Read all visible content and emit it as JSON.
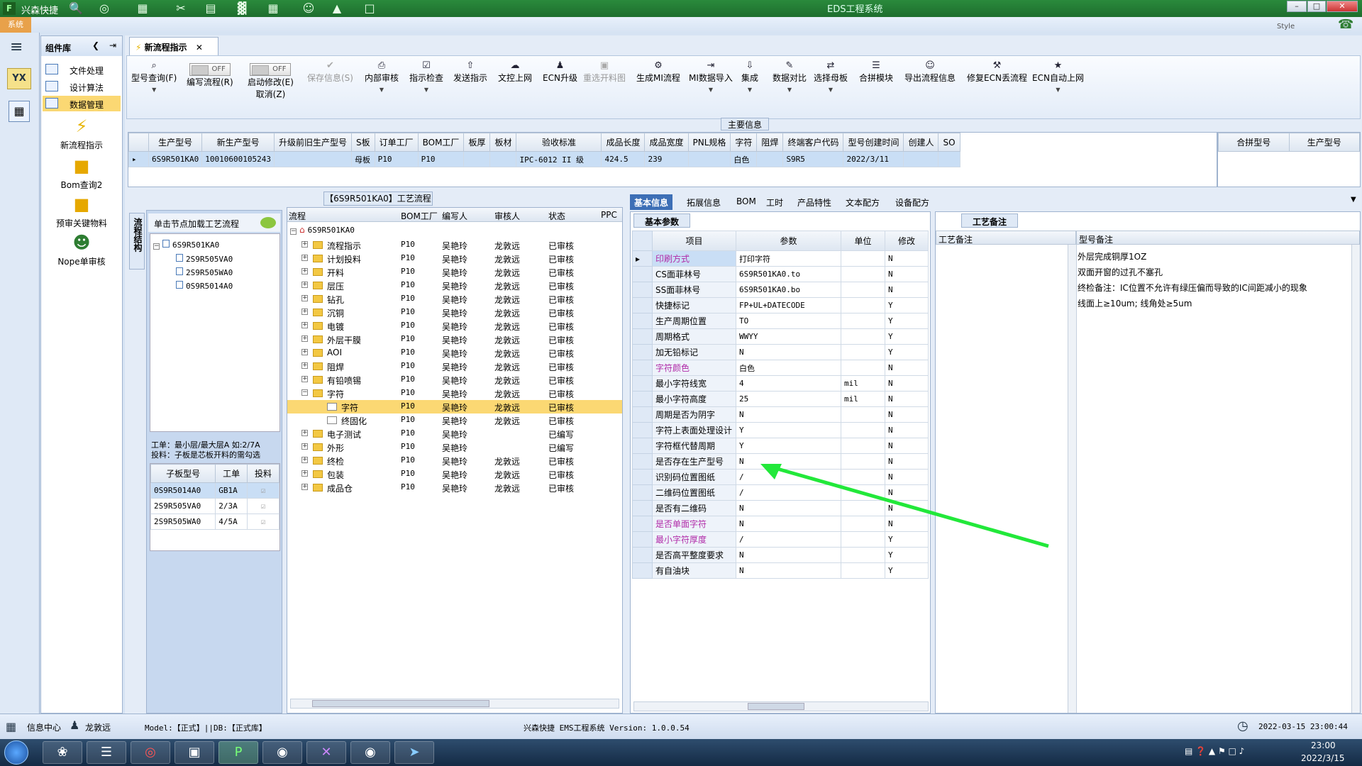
{
  "window": {
    "app_name": "兴森快捷",
    "title": "EDS工程系统",
    "style_label": "Style"
  },
  "sysbar": {
    "tab": "系统"
  },
  "component_panel": {
    "title": "组件库",
    "nav": [
      "文件处理",
      "设计算法",
      "数据管理"
    ],
    "big_buttons": [
      "新流程指示",
      "Bom查询2",
      "预审关键物料",
      "Nope单审核"
    ]
  },
  "doc_tab": {
    "label": "新流程指示"
  },
  "ribbon": {
    "query": "型号查询(F)",
    "write_flow": "编写流程(R)",
    "start_modify": "启动修改(E)",
    "cancel": "取消(Z)",
    "toggle_off": "OFF",
    "save_info": "保存信息(S)",
    "internal_review": "内部审核",
    "check": "指示检查",
    "send": "发送指示",
    "upload": "文控上网",
    "ecn_upgrade": "ECN升级",
    "reselect_image": "重选开料图",
    "gen_mi": "生成MI流程",
    "mi_import": "MI数据导入",
    "integrate": "集成",
    "compare": "数据对比",
    "select_master": "选择母板",
    "merge_module": "合拼模块",
    "export_info": "导出流程信息",
    "fix_ecn": "修复ECN丢流程",
    "ecn_auto": "ECN自动上网"
  },
  "main_info": {
    "label": "主要信息",
    "headers": [
      "生产型号",
      "新生产型号",
      "升级前旧生产型号",
      "S板",
      "订单工厂",
      "BOM工厂",
      "板厚",
      "板材",
      "验收标准",
      "成品长度",
      "成品宽度",
      "PNL规格",
      "字符",
      "阻焊",
      "终端客户代码",
      "型号创建时间",
      "创建人",
      "SO"
    ],
    "row": [
      "6S9R501KA0",
      "10010600105243",
      "",
      "母板",
      "P10",
      "P10",
      "",
      "",
      "IPC-6012 II 级",
      "424.5",
      "239",
      "",
      "白色",
      "",
      "S9R5",
      "2022/3/11",
      "",
      ""
    ],
    "right_headers": [
      "合拼型号",
      "生产型号"
    ]
  },
  "process": {
    "label": "【6S9R501KA0】工艺流程",
    "side_tab": "流程结构",
    "load_hint": "单击节点加载工艺流程",
    "tree_root": "6S9R501KA0",
    "tree_children": [
      "2S9R505VA0",
      "2S9R505WA0",
      "0S9R5014A0"
    ],
    "note_line1": "工单：最小层/最大层A 如:2/7A",
    "note_line2": "投料：子板是芯板开料的需勾选",
    "sub_headers": [
      "子板型号",
      "工单",
      "投料"
    ],
    "sub_rows": [
      [
        "0S9R5014A0",
        "GB1A"
      ],
      [
        "2S9R505VA0",
        "2/3A"
      ],
      [
        "2S9R505WA0",
        "4/5A"
      ]
    ],
    "flow_headers": [
      "流程",
      "BOM工厂",
      "编写人",
      "审核人",
      "状态",
      "PPC"
    ],
    "flow_root": "6S9R501KA0",
    "flow_rows": [
      [
        "流程指示",
        "P10",
        "吴艳玲",
        "龙敦远",
        "已审核"
      ],
      [
        "计划投料",
        "P10",
        "吴艳玲",
        "龙敦远",
        "已审核"
      ],
      [
        "开料",
        "P10",
        "吴艳玲",
        "龙敦远",
        "已审核"
      ],
      [
        "层压",
        "P10",
        "吴艳玲",
        "龙敦远",
        "已审核"
      ],
      [
        "钻孔",
        "P10",
        "吴艳玲",
        "龙敦远",
        "已审核"
      ],
      [
        "沉铜",
        "P10",
        "吴艳玲",
        "龙敦远",
        "已审核"
      ],
      [
        "电镀",
        "P10",
        "吴艳玲",
        "龙敦远",
        "已审核"
      ],
      [
        "外层干膜",
        "P10",
        "吴艳玲",
        "龙敦远",
        "已审核"
      ],
      [
        "AOI",
        "P10",
        "吴艳玲",
        "龙敦远",
        "已审核"
      ],
      [
        "阻焊",
        "P10",
        "吴艳玲",
        "龙敦远",
        "已审核"
      ],
      [
        "有铅喷锡",
        "P10",
        "吴艳玲",
        "龙敦远",
        "已审核"
      ],
      [
        "字符",
        "P10",
        "吴艳玲",
        "龙敦远",
        "已审核"
      ],
      [
        "字符",
        "P10",
        "吴艳玲",
        "龙敦远",
        "已审核"
      ],
      [
        "终固化",
        "P10",
        "吴艳玲",
        "龙敦远",
        "已审核"
      ],
      [
        "电子测试",
        "P10",
        "吴艳玲",
        "",
        "已编写"
      ],
      [
        "外形",
        "P10",
        "吴艳玲",
        "",
        "已编写"
      ],
      [
        "终检",
        "P10",
        "吴艳玲",
        "龙敦远",
        "已审核"
      ],
      [
        "包装",
        "P10",
        "吴艳玲",
        "龙敦远",
        "已审核"
      ],
      [
        "成品仓",
        "P10",
        "吴艳玲",
        "龙敦远",
        "已审核"
      ]
    ]
  },
  "info_tabs": [
    "基本信息",
    "拓展信息",
    "BOM",
    "工时",
    "产品特性",
    "文本配方",
    "设备配方"
  ],
  "params": {
    "label": "基本参数",
    "headers": [
      "项目",
      "参数",
      "单位",
      "修改"
    ],
    "rows": [
      [
        "印刷方式",
        "打印字符",
        "",
        "N"
      ],
      [
        "CS面菲林号",
        "6S9R501KA0.to",
        "",
        "N"
      ],
      [
        "SS面菲林号",
        "6S9R501KA0.bo",
        "",
        "N"
      ],
      [
        "快捷标记",
        "FP+UL+DATECODE",
        "",
        "Y"
      ],
      [
        "生产周期位置",
        "TO",
        "",
        "Y"
      ],
      [
        "周期格式",
        "WWYY",
        "",
        "Y"
      ],
      [
        "加无铅标记",
        "N",
        "",
        "Y"
      ],
      [
        "字符颜色",
        "白色",
        "",
        "N"
      ],
      [
        "最小字符线宽",
        "4",
        "mil",
        "N"
      ],
      [
        "最小字符高度",
        "25",
        "mil",
        "N"
      ],
      [
        "周期是否为阴字",
        "N",
        "",
        "N"
      ],
      [
        "字符上表面处理设计",
        "Y",
        "",
        "N"
      ],
      [
        "字符框代替周期",
        "Y",
        "",
        "N"
      ],
      [
        "是否存在生产型号",
        "N",
        "",
        "N"
      ],
      [
        "识别码位置图纸",
        "/",
        "",
        "N"
      ],
      [
        "二维码位置图纸",
        "/",
        "",
        "N"
      ],
      [
        "是否有二维码",
        "N",
        "",
        "N"
      ],
      [
        "是否单面字符",
        "N",
        "",
        "N"
      ],
      [
        "最小字符厚度",
        "/",
        "",
        "Y"
      ],
      [
        "是否高平整度要求",
        "N",
        "",
        "Y"
      ],
      [
        "有自油块",
        "N",
        "",
        "Y"
      ]
    ]
  },
  "remarks": {
    "tab": "工艺备注",
    "col1": "工艺备注",
    "col2": "型号备注",
    "lines": [
      "外层完成铜厚1OZ",
      "双面开窗的过孔不塞孔",
      "终检备注：IC位置不允许有绿压偏而导致的IC间距减小的现象",
      "线面上≥10um; 线角处≥5um"
    ]
  },
  "status": {
    "info_center": "信息中心",
    "user": "龙敦远",
    "model": "Model:【正式】||DB:【正式库】",
    "version": "兴森快捷 EMS工程系统 Version: 1.0.0.54",
    "datetime": "2022-03-15 23:00:44"
  },
  "taskbar": {
    "time": "23:00",
    "date": "2022/3/15"
  },
  "colors": {
    "accent": "#2e7d32",
    "highlight": "#fbd873",
    "magenta_label": "#b02aa8",
    "arrow": "#22e83a"
  }
}
